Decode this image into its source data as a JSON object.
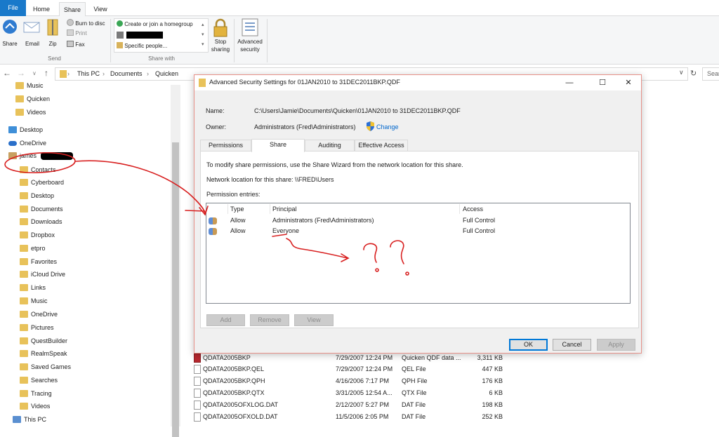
{
  "ribbon": {
    "tabs": [
      "File",
      "Home",
      "Share",
      "View"
    ],
    "share_group": {
      "share": "Share",
      "email": "Email",
      "zip": "Zip",
      "burn": "Burn to disc",
      "print": "Print",
      "fax": "Fax",
      "label": "Send"
    },
    "sharewith_group": {
      "homegroup": "Create or join a homegroup",
      "specific": "Specific people...",
      "label": "Share with"
    },
    "stop_sharing": [
      "Stop",
      "sharing"
    ],
    "advanced_security": [
      "Advanced",
      "security"
    ]
  },
  "address": {
    "crumbs": [
      "This PC",
      "Documents",
      "Quicken"
    ],
    "search_placeholder": "Sear"
  },
  "nav": {
    "items": [
      {
        "label": "Music",
        "icon": "music-folder-icon"
      },
      {
        "label": "Quicken",
        "icon": "folder-icon"
      },
      {
        "label": "Videos",
        "icon": "video-folder-icon"
      },
      {
        "label": "Desktop",
        "icon": "desktop-icon"
      },
      {
        "label": "OneDrive",
        "icon": "cloud-icon"
      },
      {
        "label": "james",
        "icon": "user-icon"
      },
      {
        "label": "Contacts",
        "icon": "folder-icon"
      },
      {
        "label": "Cyberboard",
        "icon": "folder-icon"
      },
      {
        "label": "Desktop",
        "icon": "folder-icon"
      },
      {
        "label": "Documents",
        "icon": "folder-icon"
      },
      {
        "label": "Downloads",
        "icon": "folder-icon"
      },
      {
        "label": "Dropbox",
        "icon": "folder-icon"
      },
      {
        "label": "etpro",
        "icon": "folder-icon"
      },
      {
        "label": "Favorites",
        "icon": "folder-icon"
      },
      {
        "label": "iCloud Drive",
        "icon": "folder-icon"
      },
      {
        "label": "Links",
        "icon": "folder-icon"
      },
      {
        "label": "Music",
        "icon": "music-folder-icon"
      },
      {
        "label": "OneDrive",
        "icon": "folder-icon"
      },
      {
        "label": "Pictures",
        "icon": "folder-icon"
      },
      {
        "label": "QuestBuilder",
        "icon": "folder-icon"
      },
      {
        "label": "RealmSpeak",
        "icon": "folder-icon"
      },
      {
        "label": "Saved Games",
        "icon": "folder-icon"
      },
      {
        "label": "Searches",
        "icon": "folder-icon"
      },
      {
        "label": "Tracing",
        "icon": "folder-icon"
      },
      {
        "label": "Videos",
        "icon": "folder-icon"
      },
      {
        "label": "This PC",
        "icon": "computer-icon"
      }
    ]
  },
  "files": [
    {
      "name": "QDATA2005BKP",
      "date": "7/29/2007 12:24 PM",
      "type": "Quicken QDF data ...",
      "size": "3,311 KB"
    },
    {
      "name": "QDATA2005BKP.QEL",
      "date": "7/29/2007 12:24 PM",
      "type": "QEL File",
      "size": "447 KB"
    },
    {
      "name": "QDATA2005BKP.QPH",
      "date": "4/16/2006 7:17 PM",
      "type": "QPH File",
      "size": "176 KB"
    },
    {
      "name": "QDATA2005BKP.QTX",
      "date": "3/31/2005 12:54 A...",
      "type": "QTX File",
      "size": "6 KB"
    },
    {
      "name": "QDATA2005OFXLOG.DAT",
      "date": "2/12/2007 5:27 PM",
      "type": "DAT File",
      "size": "198 KB"
    },
    {
      "name": "QDATA2005OFXOLD.DAT",
      "date": "11/5/2006 2:05 PM",
      "type": "DAT File",
      "size": "252 KB"
    }
  ],
  "dialog": {
    "title": "Advanced Security Settings for 01JAN2010 to 31DEC2011BKP.QDF",
    "name_label": "Name:",
    "name_value": "C:\\Users\\Jamie\\Documents\\Quicken\\01JAN2010 to 31DEC2011BKP.QDF",
    "owner_label": "Owner:",
    "owner_value": "Administrators (Fred\\Administrators)",
    "change_link": "Change",
    "tabs": [
      "Permissions",
      "Share",
      "Auditing",
      "Effective Access"
    ],
    "instructions": "To modify share permissions, use the Share Wizard from the network location for this share.",
    "network_location": "Network location for this share:  \\\\FRED\\Users",
    "entries_label": "Permission entries:",
    "columns": [
      "Type",
      "Principal",
      "Access"
    ],
    "entries": [
      {
        "type": "Allow",
        "principal": "Administrators (Fred\\Administrators)",
        "access": "Full Control"
      },
      {
        "type": "Allow",
        "principal": "Everyone",
        "access": "Full Control"
      }
    ],
    "buttons": {
      "add": "Add",
      "remove": "Remove",
      "view": "View",
      "ok": "OK",
      "cancel": "Cancel",
      "apply": "Apply"
    }
  }
}
